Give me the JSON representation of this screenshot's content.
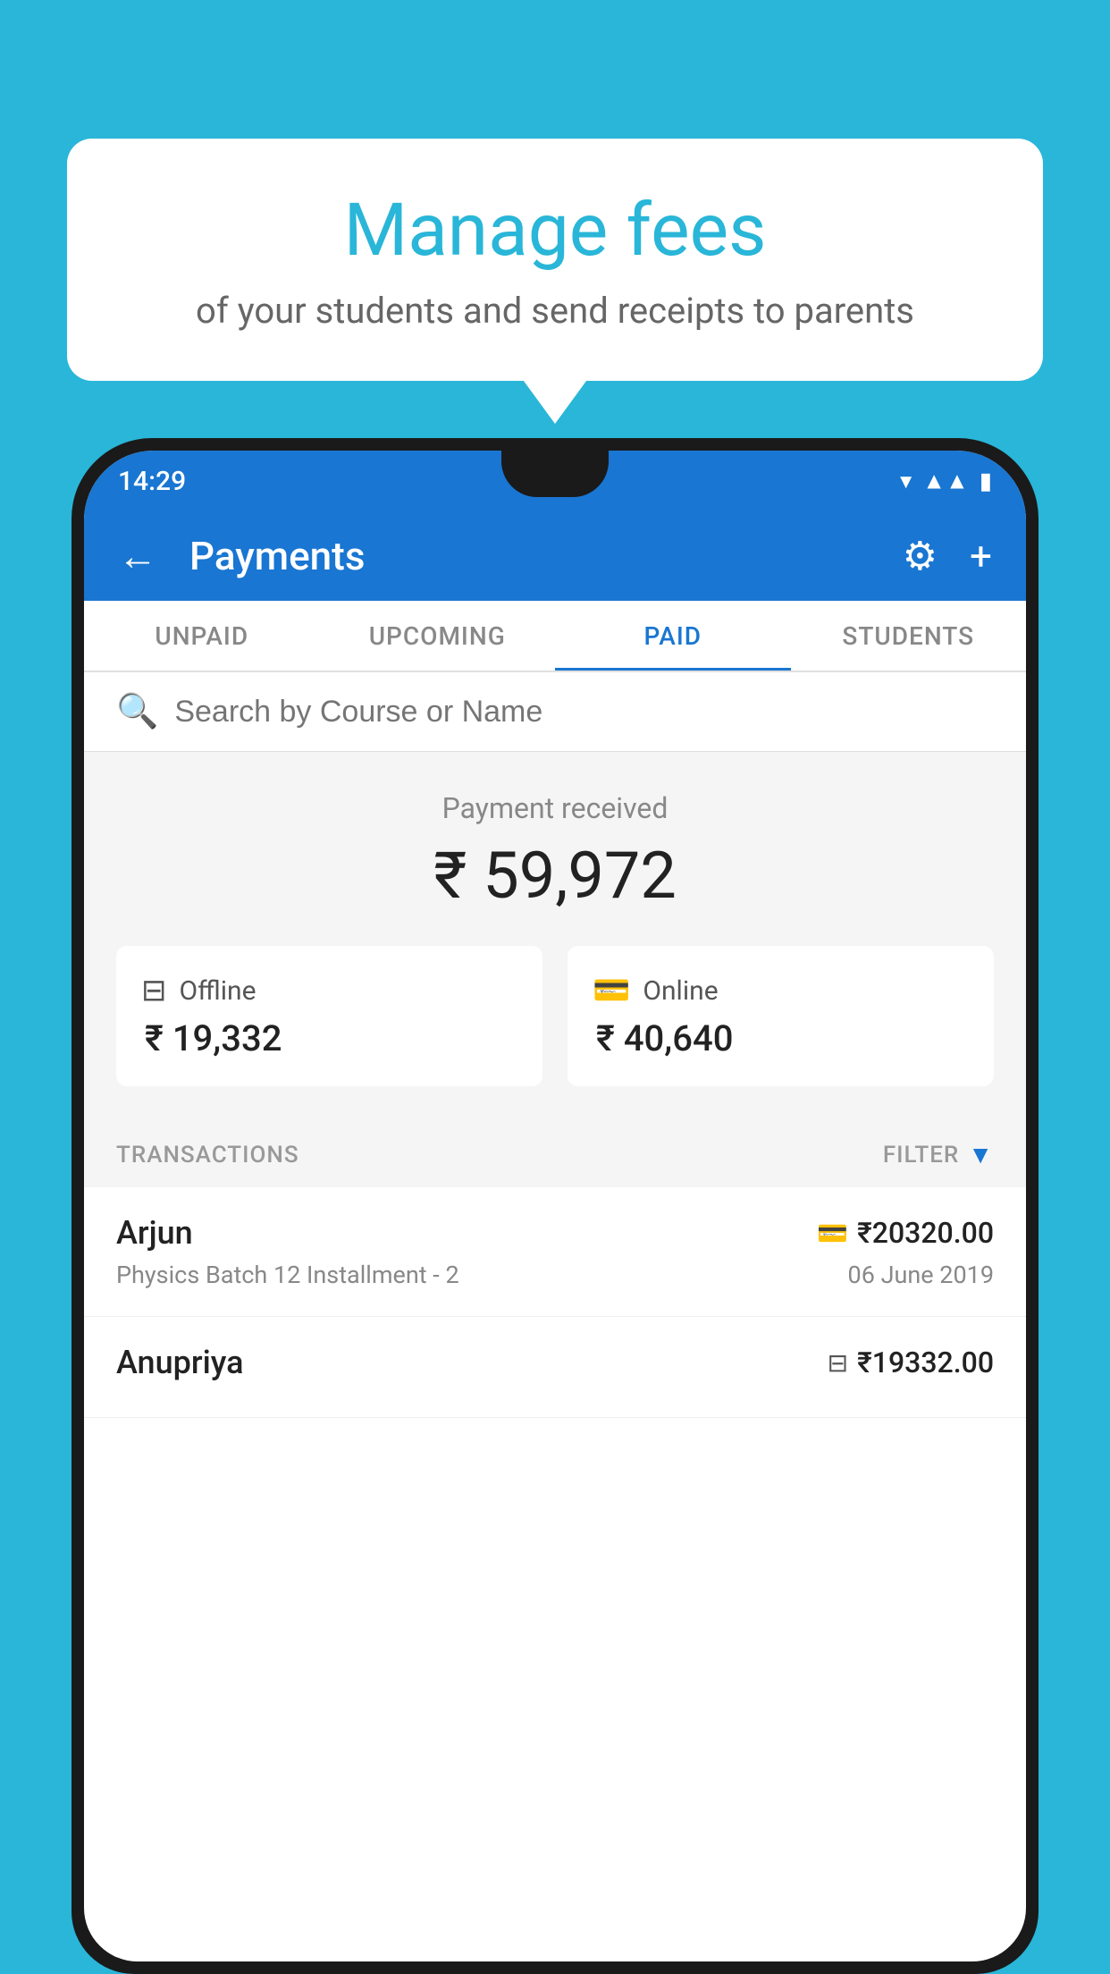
{
  "bubble": {
    "title": "Manage fees",
    "subtitle": "of your students and send receipts to parents"
  },
  "status_bar": {
    "time": "14:29",
    "icons": [
      "▾▾",
      "▲▲",
      "▮"
    ]
  },
  "app_bar": {
    "title": "Payments",
    "back_label": "←",
    "settings_label": "⚙",
    "add_label": "+"
  },
  "tabs": [
    {
      "label": "UNPAID",
      "active": false
    },
    {
      "label": "UPCOMING",
      "active": false
    },
    {
      "label": "PAID",
      "active": true
    },
    {
      "label": "STUDENTS",
      "active": false
    }
  ],
  "search": {
    "placeholder": "Search by Course or Name"
  },
  "payment_summary": {
    "label": "Payment received",
    "amount": "₹ 59,972"
  },
  "cards": [
    {
      "icon": "offline",
      "label": "Offline",
      "amount": "₹ 19,332"
    },
    {
      "icon": "online",
      "label": "Online",
      "amount": "₹ 40,640"
    }
  ],
  "transactions_label": "TRANSACTIONS",
  "filter_label": "FILTER",
  "transactions": [
    {
      "name": "Arjun",
      "amount": "₹20320.00",
      "course": "Physics Batch 12 Installment - 2",
      "date": "06 June 2019",
      "payment_type": "online"
    },
    {
      "name": "Anupriya",
      "amount": "₹19332.00",
      "course": "",
      "date": "",
      "payment_type": "offline"
    }
  ]
}
